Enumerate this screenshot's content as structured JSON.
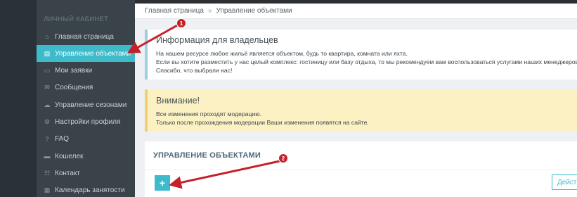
{
  "sidebar": {
    "title": "ЛИЧНЫЙ КАБИНЕТ",
    "items": [
      {
        "label": "Главная страница",
        "icon": "home-icon",
        "glyph": "⌂"
      },
      {
        "label": "Управление объектами",
        "icon": "building-icon",
        "glyph": "▤",
        "active": true
      },
      {
        "label": "Мои заявки",
        "icon": "file-icon",
        "glyph": "▭"
      },
      {
        "label": "Сообщения",
        "icon": "envelope-icon",
        "glyph": "✉"
      },
      {
        "label": "Управление сезонами",
        "icon": "cloud-icon",
        "glyph": "☁"
      },
      {
        "label": "Настройки профиля",
        "icon": "gear-icon",
        "glyph": "⚙"
      },
      {
        "label": "FAQ",
        "icon": "question-icon",
        "glyph": "?"
      },
      {
        "label": "Кошелек",
        "icon": "wallet-icon",
        "glyph": "▬"
      },
      {
        "label": "Контакт",
        "icon": "contacts-icon",
        "glyph": "☷"
      },
      {
        "label": "Календарь занятости",
        "icon": "calendar-icon",
        "glyph": "▦"
      }
    ]
  },
  "breadcrumb": {
    "home": "Главная страница",
    "separator": "»",
    "current": "Управление объектами"
  },
  "info": {
    "title": "Информация для владельцев",
    "line1": "На нашем ресурсе любое жильё является объектом, будь то квартира, комната или яхта.",
    "line2": "Если вы хотите разместить у нас целый комплекс: гостиницу или базу отдыха, то мы рекомендуем вам воспользоваться услугами наших менеджеров.",
    "line3": "Спасибо, что выбрали нас!"
  },
  "warning": {
    "title": "Внимание!",
    "line1": "Все изменения проходят модерацию.",
    "line2": "Только после прохождения модерации Ваши изменения появятся на сайте."
  },
  "objects": {
    "heading": "УПРАВЛЕНИЕ ОБЪЕКТАМИ",
    "add_label": "+",
    "actions_label": "Действия"
  },
  "annotations": {
    "badge1": "1",
    "badge2": "2"
  },
  "colors": {
    "accent": "#3ebbcb",
    "sidebar": "#394349",
    "marker": "#c5202a"
  }
}
